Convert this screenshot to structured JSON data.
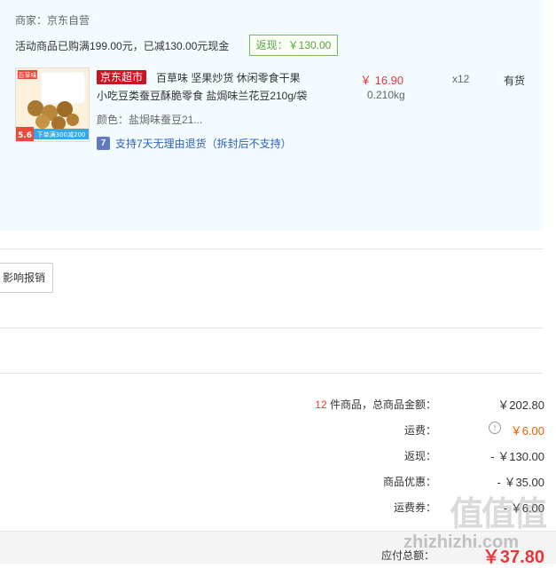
{
  "shop": {
    "merchant": "商家：京东自营",
    "promo": "活动商品已购满199.00元，已减130.00元现金",
    "rebate_tag": "返现：￥130.00"
  },
  "product": {
    "thumb_brand": "百草味",
    "thumb_badge": "5.6",
    "thumb_banner": "下单满300减200",
    "supermarket_tag": "京东超市",
    "title_line1": "百草味 坚果炒货 休闲零食干果",
    "title_line2": "小吃豆类蚕豆酥脆零食 盐焗味兰花豆210g/袋",
    "color_line": "颜色：盐焗味蚕豆21...",
    "support_icon": "7",
    "support_text": "支持7天无理由退货（拆封后不支持）",
    "price": "￥ 16.90",
    "weight": "0.210kg",
    "qty": "x12",
    "stock": "有货"
  },
  "invoice_button": "影响报销",
  "summary": {
    "count_num": "12",
    "count_text": " 件商品，总商品金额：",
    "goods_total": "￥202.80",
    "shipping_label": "运费：",
    "shipping_value": "￥6.00",
    "rebate_label": "返现：",
    "rebate_value": "- ￥130.00",
    "discount_label": "商品优惠：",
    "discount_value": "- ￥35.00",
    "coupon_label": "运费券：",
    "coupon_value": "- ￥6.00",
    "payable_label": "应付总额：",
    "payable_value": "￥37.80"
  },
  "watermark": {
    "glyphs": "值值值",
    "url": "zhizhizhi.com"
  },
  "colors": {
    "accent_red": "#e4393c",
    "shipping_orange": "#ee5b00",
    "rebate_green": "#5aa33f",
    "link_blue": "#2e62b7",
    "shop_bg": "#f3fbfe"
  }
}
